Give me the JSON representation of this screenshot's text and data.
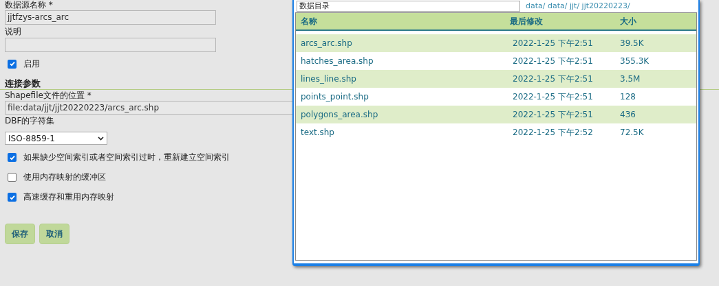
{
  "form": {
    "name_label": "数据源名称 *",
    "name_value": "jjtfzys-arcs_arc",
    "description_label": "说明",
    "enabled": {
      "label": "启用",
      "checked": true
    },
    "section_title": "连接参数",
    "shapefile_label": "Shapefile文件的位置 *",
    "shapefile_value": "file:data/jjt/jjt20220223/arcs_arc.shp",
    "charset_label": "DBF的字符集",
    "charset_value": "ISO-8859-1",
    "options": [
      {
        "label": "如果缺少空间索引或者空间索引过时，重新建立空间索引",
        "checked": true
      },
      {
        "label": "使用内存映射的缓冲区",
        "checked": false
      },
      {
        "label": "高速缓存和重用内存映射",
        "checked": true
      }
    ],
    "buttons": [
      "保存",
      "取消"
    ]
  },
  "dialog": {
    "directory_value": "数据目录",
    "path": "data/ data/ jjt/ jjt20220223/",
    "columns": [
      "名称",
      "最后修改",
      "大小"
    ],
    "rows": [
      {
        "name": "arcs_arc.shp",
        "modified": "2022-1-25 下午2:51",
        "size": "39.5K"
      },
      {
        "name": "hatches_area.shp",
        "modified": "2022-1-25 下午2:51",
        "size": "355.3K"
      },
      {
        "name": "lines_line.shp",
        "modified": "2022-1-25 下午2:51",
        "size": "3.5M"
      },
      {
        "name": "points_point.shp",
        "modified": "2022-1-25 下午2:51",
        "size": "128"
      },
      {
        "name": "polygons_area.shp",
        "modified": "2022-1-25 下午2:51",
        "size": "436"
      },
      {
        "name": "text.shp",
        "modified": "2022-1-25 下午2:52",
        "size": "72.5K"
      }
    ]
  }
}
